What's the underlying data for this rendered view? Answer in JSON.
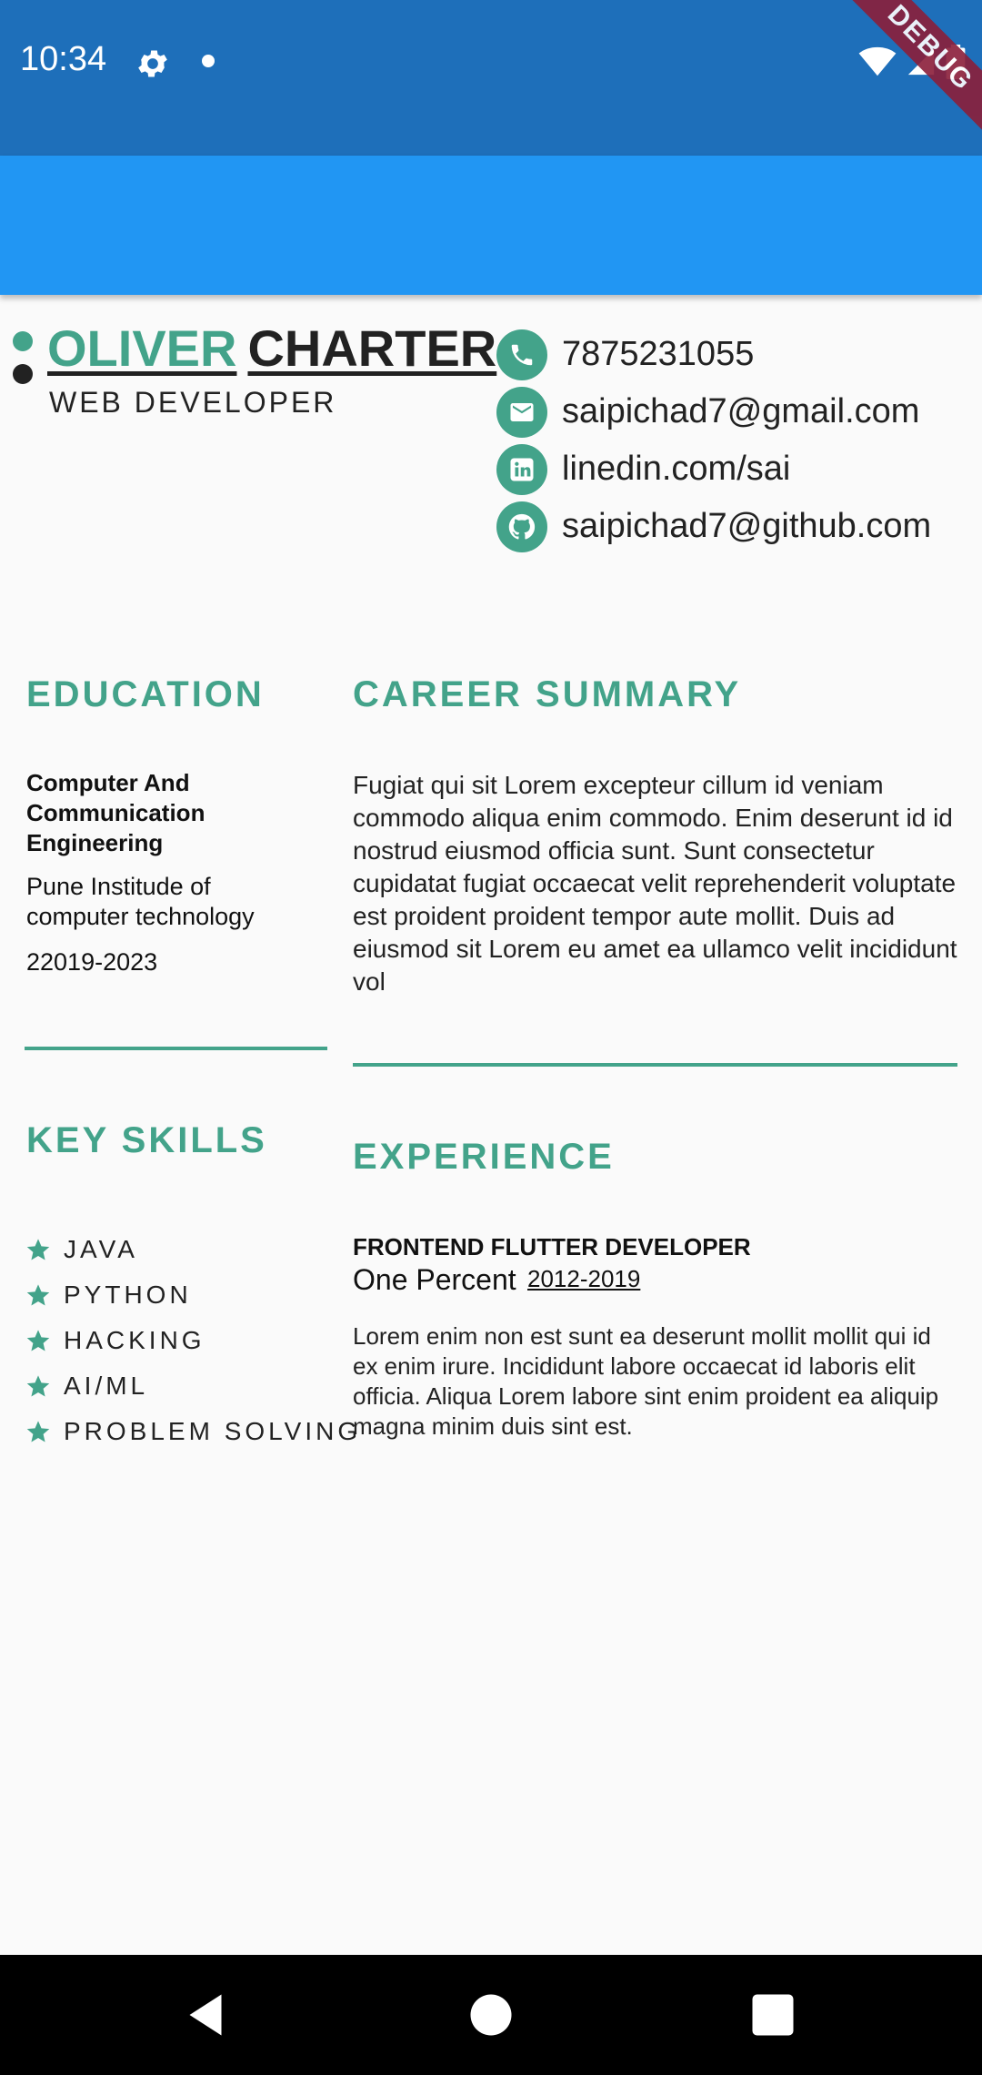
{
  "status_bar": {
    "time": "10:34",
    "debug_label": "DEBUG"
  },
  "header": {
    "first_name": "OLIVER",
    "last_name": "CHARTER",
    "role": "WEB DEVELOPER"
  },
  "contacts": [
    {
      "icon": "phone-icon",
      "text": "7875231055"
    },
    {
      "icon": "email-icon",
      "text": "saipichad7@gmail.com"
    },
    {
      "icon": "linkedin-icon",
      "text": "linedin.com/sai"
    },
    {
      "icon": "github-icon",
      "text": "saipichad7@github.com"
    }
  ],
  "education": {
    "title": "EDUCATION",
    "degree": "Computer And Communication Engineering",
    "institute": "Pune Institude of computer technology",
    "years": "22019-2023"
  },
  "career": {
    "title": "CAREER SUMMARY",
    "text": "Fugiat qui sit Lorem excepteur cillum id veniam commodo aliqua enim commodo. Enim deserunt id id nostrud eiusmod officia sunt. Sunt consectetur cupidatat fugiat occaecat velit reprehenderit voluptate est proident proident tempor aute mollit. Duis ad eiusmod sit Lorem eu amet ea ullamco velit incididunt vol"
  },
  "skills": {
    "title": "KEY SKILLS",
    "items": [
      "JAVA",
      "PYTHON",
      "HACKING",
      "AI/ML",
      "PROBLEM SOLVING"
    ]
  },
  "experience": {
    "title": "EXPERIENCE",
    "role": "FRONTEND FLUTTER DEVELOPER",
    "company": "One Percent",
    "years": "2012-2019",
    "description": "Lorem enim non est sunt ea deserunt mollit mollit qui id ex enim irure. Incididunt labore occaecat id laboris elit officia. Aliqua Lorem labore sint enim proident ea aliquip magna minim duis sint est."
  },
  "colors": {
    "accent": "#43a38a",
    "app_bar": "#2196f3",
    "status_bar": "#1e6fba"
  }
}
